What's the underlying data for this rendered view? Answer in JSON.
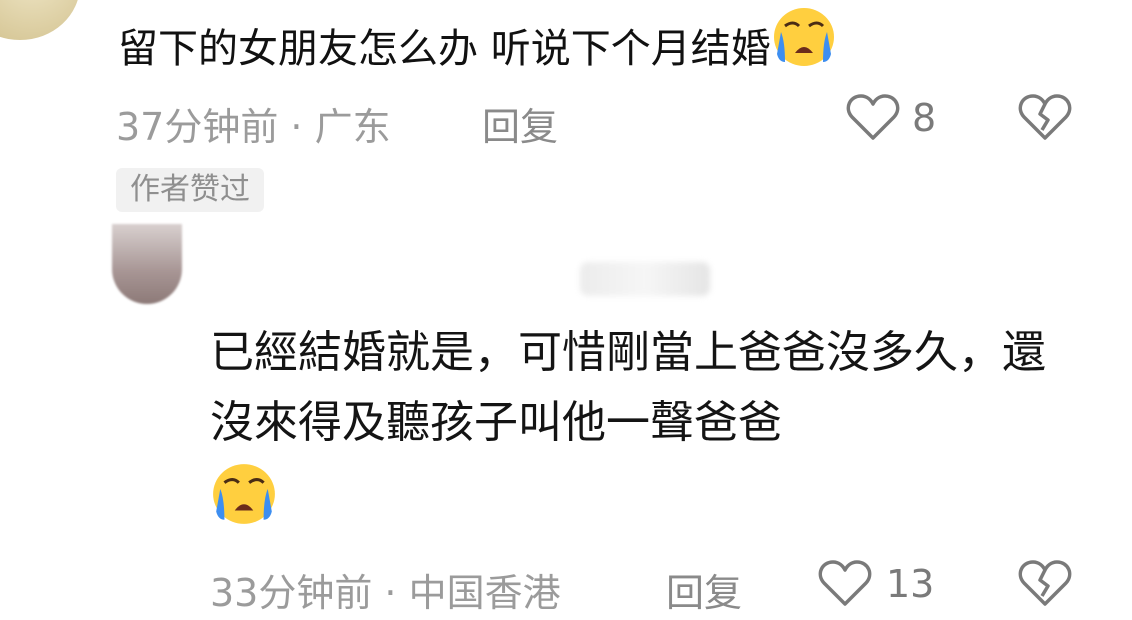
{
  "comment1": {
    "text": "留下的女朋友怎么办  听说下个月结婚",
    "emoji": "crying-emoji",
    "meta": "37分钟前 · 广东",
    "reply_label": "回复",
    "like_count": "8",
    "badge": "作者赞过"
  },
  "comment2": {
    "text": "已經結婚就是，可惜剛當上爸爸沒多久，還沒來得及聽孩子叫他一聲爸爸",
    "emoji": "crying-emoji",
    "meta": "33分钟前 · 中国香港",
    "reply_label": "回复",
    "like_count": "13"
  },
  "colors": {
    "emoji_yellow": "#ffcf3f",
    "emoji_tear": "#3d8ef0",
    "meta_gray": "#9b9b9b"
  }
}
